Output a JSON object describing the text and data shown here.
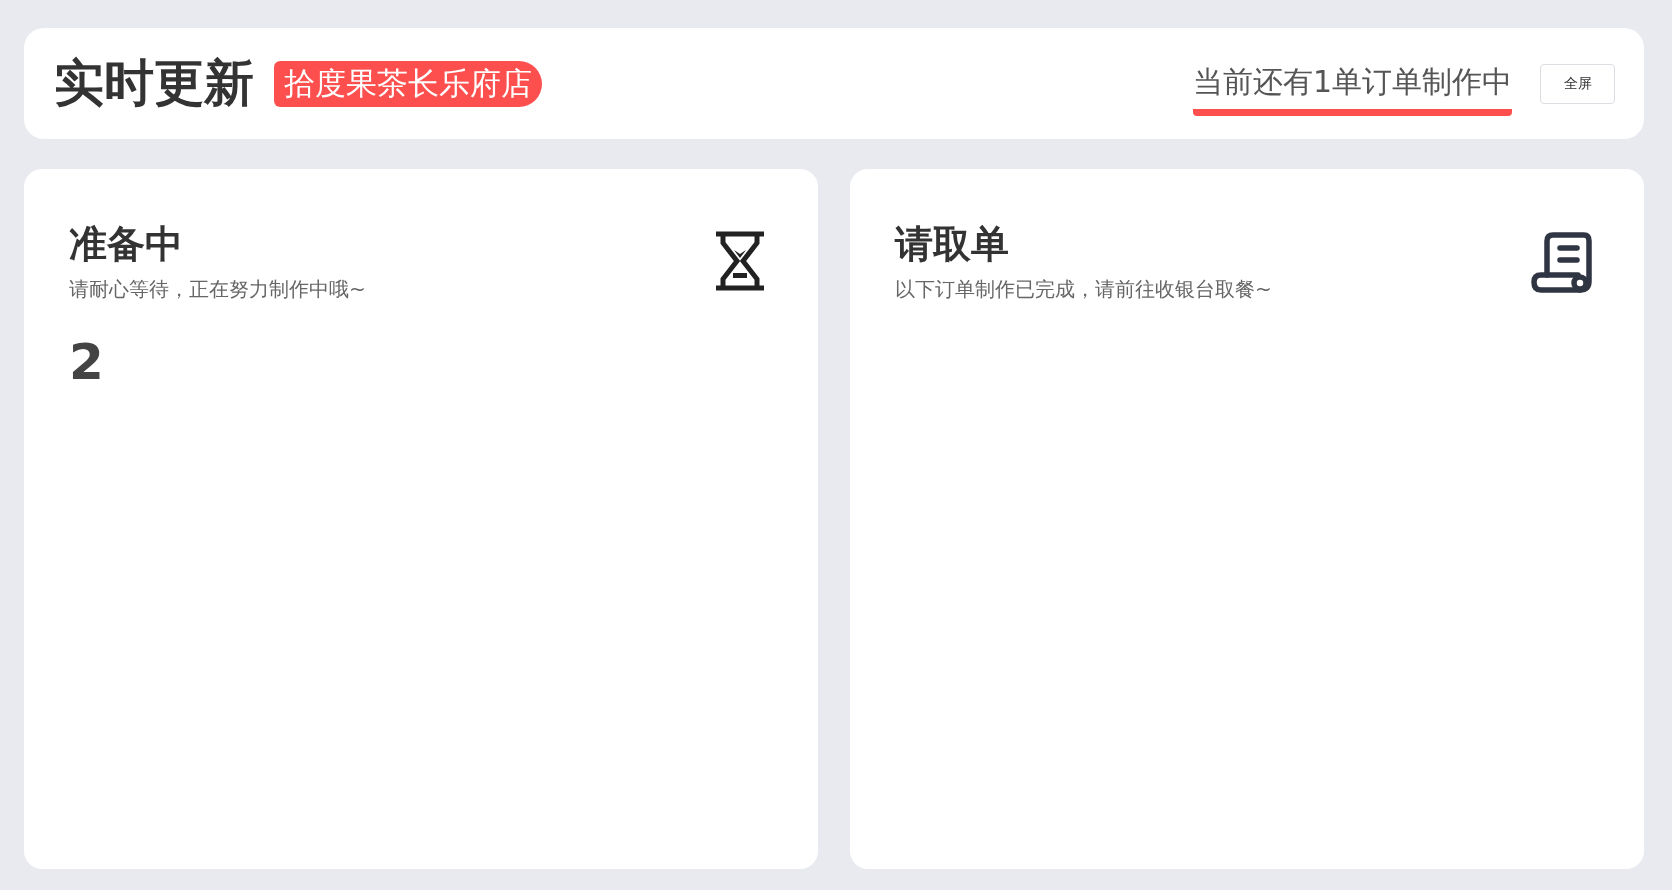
{
  "header": {
    "title": "实时更新",
    "store": "拾度果茶长乐府店",
    "status": "当前还有1单订单制作中",
    "fullscreen_button": "全屏"
  },
  "panels": [
    {
      "kind": "preparing",
      "title": "准备中",
      "subtitle": "请耐心等待，正在努力制作中哦~",
      "orders": [
        "2"
      ]
    },
    {
      "kind": "pickup",
      "title": "请取单",
      "subtitle": "以下订单制作已完成，请前往收银台取餐~"
    }
  ]
}
